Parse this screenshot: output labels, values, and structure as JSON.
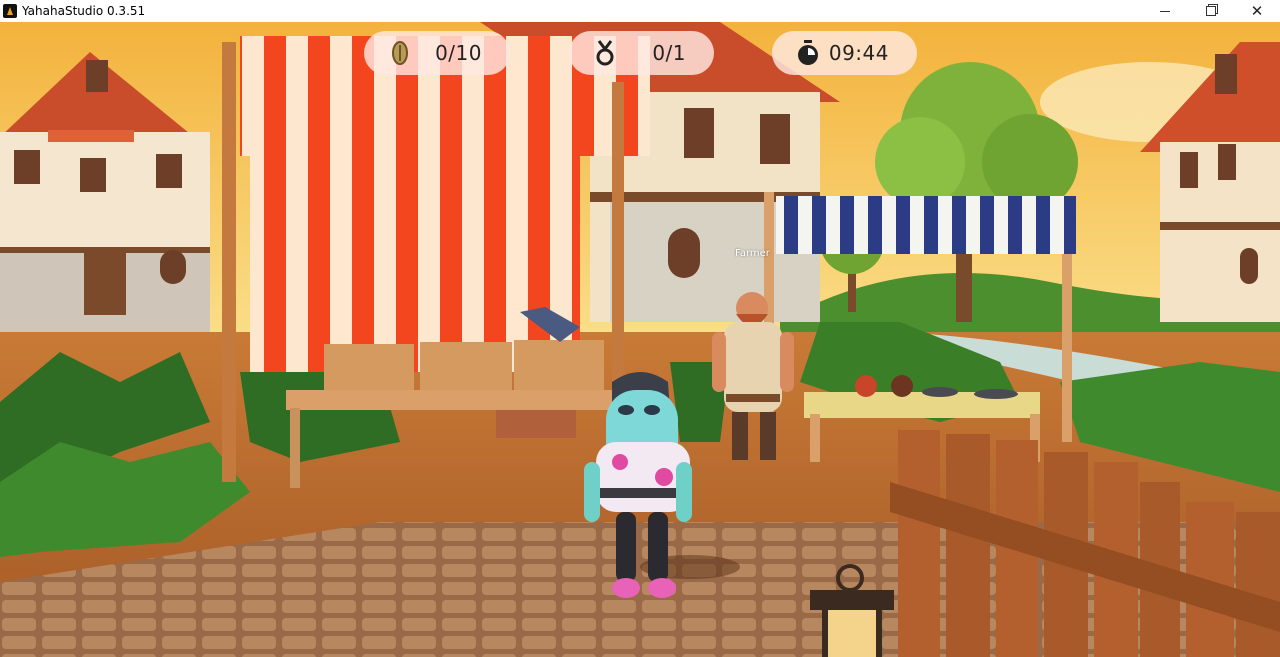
{
  "window": {
    "title": "YahahaStudio 0.3.51",
    "controls": {
      "minimize": "",
      "maximize": "",
      "close": "✕"
    }
  },
  "hud": {
    "coins": {
      "icon": "coin-icon",
      "value": "0/10"
    },
    "medals": {
      "icon": "medal-icon",
      "value": "0/1"
    },
    "timer": {
      "icon": "stopwatch-icon",
      "value": "09:44"
    }
  },
  "npc": {
    "name": "Farmer"
  },
  "colors": {
    "sky": "#f5c45a",
    "grass": "#3f8a2a",
    "path": "#b86a2e",
    "awning_red": "#f04a25",
    "awning_blue": "#2f3f8a"
  }
}
